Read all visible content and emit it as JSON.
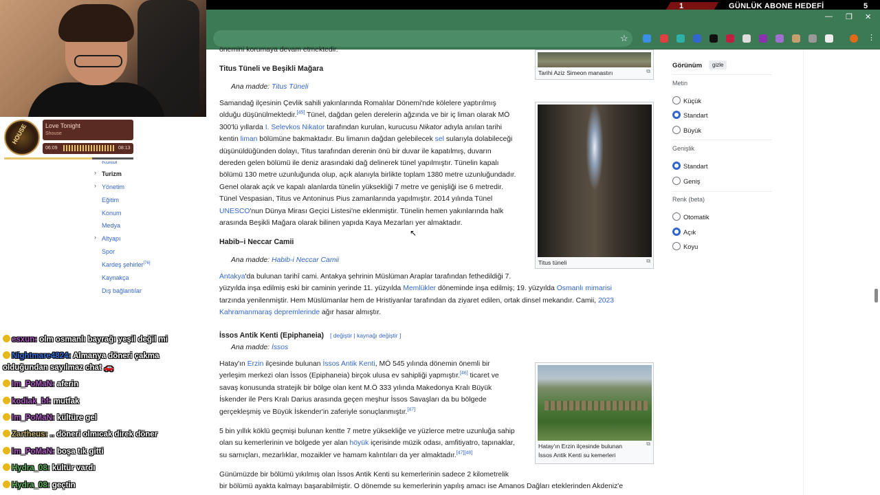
{
  "stream": {
    "goal_number": "1",
    "goal_label": "GÜNLÜK ABONE HEDEFİ",
    "goal_count": "5"
  },
  "music": {
    "album_text": "HOUSE",
    "title": "Love Tonight",
    "artist": "Shouse",
    "time_elapsed": "06:09",
    "time_total": "08:13",
    "progress_fraction": 0.68
  },
  "toc": {
    "items": [
      {
        "label": "Kültür",
        "has_chevron": false
      },
      {
        "label": "Turizm",
        "has_chevron": true,
        "active": true
      },
      {
        "label": "Yönetim",
        "has_chevron": true
      },
      {
        "label": "Eğitim",
        "has_chevron": false
      },
      {
        "label": "Konum",
        "has_chevron": false
      },
      {
        "label": "Medya",
        "has_chevron": false
      },
      {
        "label": "Altyapı",
        "has_chevron": true
      },
      {
        "label": "Spor",
        "has_chevron": false
      },
      {
        "label": "Kardeş şehirler",
        "sup": "[76]",
        "has_chevron": false
      },
      {
        "label": "Kaynakça",
        "has_chevron": false
      },
      {
        "label": "Dış bağlantılar",
        "has_chevron": false
      }
    ]
  },
  "chat": [
    {
      "user": "esxun:",
      "text": "olm osmanlı bayrağı yeşil değil mi",
      "color": "#b05cc2"
    },
    {
      "user": "Nightmare4824:",
      "text": "Almanya döneri çakma",
      "color": "#2f6fd6"
    },
    {
      "user": "",
      "text": "olduğundan sayılmaz chat 🚗",
      "color": "#ffffff"
    },
    {
      "user": "Im_PoMaN:",
      "text": "aferin",
      "color": "#b05cc2"
    },
    {
      "user": "kodiak_bf:",
      "text": "mutfak",
      "color": "#b05cc2"
    },
    {
      "user": "Im_PoMaN:",
      "text": "kültüre gel",
      "color": "#b05cc2"
    },
    {
      "user": "Zartheus:",
      "text": ".. döneri olmıcak direk döner",
      "color": "#c9b56a"
    },
    {
      "user": "Im_PoMaN:",
      "text": "boşa tık gitti",
      "color": "#b05cc2"
    },
    {
      "user": "Hydra_08:",
      "text": "kültür vardı",
      "color": "#5fb85a"
    },
    {
      "user": "Hydra_08:",
      "text": "geçtin",
      "color": "#5fb85a"
    }
  ],
  "article": {
    "top_fragment": "önemini korumaya devam etmektedir.",
    "section1": {
      "heading": "Titus Tüneli ve Beşikli Mağara",
      "hat_prefix": "Ana madde:",
      "hat_link": "Titus Tüneli",
      "lines": [
        [
          "Samandağ ilçesinin Çevlik sahili yakınlarında Romalılar Dönemi'nde kölelere yaptırılmış"
        ],
        [
          "olduğu düşünülmektedir.",
          {
            "sup": "[45]"
          },
          " Tünel, dağdan gelen derelerin ağzında ve bir iç liman olarak MÖ"
        ],
        [
          "300'lü yıllarda ",
          {
            "link": "I. Selevkos Nikator"
          },
          " tarafından kurulan, kurucusu ",
          {
            "i": "Nikator"
          },
          " adıyla anılan tarihi"
        ],
        [
          "kentin ",
          {
            "link": "liman"
          },
          " bölümüne bakmaktadır. Bu limanın dağdan gelebilecek ",
          {
            "link": "sel"
          },
          " sularıyla dolabileceği"
        ],
        [
          "düşünüldüğünden dolayı, Titus tarafından derenin önü bir duvar ile kapatılmış, duvarın"
        ],
        [
          "dereden gelen bölümü ile deniz arasındaki dağ delinerek tünel yapılmıştır. Tünelin kapalı"
        ],
        [
          "bölümü 130 metre uzunluğunda olup, açık alanıyla birlikte toplam 1380 metre uzunluğundadır."
        ],
        [
          "Genel olarak açık ve kapalı alanlarda tünelin yüksekliği 7 metre ve genişliği ise 6 metredir."
        ],
        [
          "Tünel Vespasian, Titus ve Antoninus Pius zamanlarında yapılmıştır. 2014 yılında Tünel"
        ],
        [
          {
            "link": "UNESCO"
          },
          "'nun Dünya Mirası Geçici Listesi'ne eklenmiştir. Tünelin hemen yakınlarında halk"
        ],
        [
          "arasında Beşikli Mağara olarak bilinen yapıda Kaya Mezarları yer almaktadır."
        ]
      ]
    },
    "section2": {
      "heading": "Habib–i Neccar Camii",
      "hat_prefix": "Ana madde:",
      "hat_link": "Habib-i Neccar Camii",
      "lines": [
        [
          {
            "link": "Antakya"
          },
          "'da bulunan tarihî cami. Antakya şehrinin Müslüman Araplar tarafından fethedildiği 7."
        ],
        [
          "yüzyılda inşa edilmiş eski bir caminin yerinde 11. yüzyılda ",
          {
            "link": "Memlükler"
          },
          " döneminde inşa edilmiş; 19. yüzyılda ",
          {
            "link": "Osmanlı mimarisi"
          }
        ],
        [
          "tarzında yenilenmiştir. Hem Müslümanlar hem de Hristiyanlar tarafından da ziyaret edilen, ortak dinsel mekandır. Camii, ",
          {
            "link": "2023"
          }
        ],
        [
          {
            "link": "Kahramanmaraş depremlerinde"
          },
          " ağır hasar almıştır."
        ]
      ]
    },
    "section3": {
      "heading": "İssos Antik Kenti (Epiphaneia)",
      "edit_links": "[ değiştir | kaynağı değiştir ]",
      "hat_prefix": "Ana madde:",
      "hat_link": "İssos",
      "para1": [
        [
          "Hatay'ın ",
          {
            "link": "Erzin"
          },
          " ilçesinde bulunan ",
          {
            "link": "İssos Antik Kenti"
          },
          ", MÖ 545 yılında dönemin önemli bir"
        ],
        [
          "yerleşim merkezi olan İssos (Epiphaneia) birçok ulusa ev sahipliği yapmıştır.",
          {
            "sup": "[46]"
          },
          " ticaret ve"
        ],
        [
          "savaş konusunda stratejik bir bölge olan kent M.Ö 333 yılında Makedonya Kralı Büyük"
        ],
        [
          "İskender ile Pers Kralı Darius arasında geçen meşhur İssos Savaşları da bu bölgede"
        ],
        [
          "gerçekleşmiş ve Büyük İskender'in zaferiyle sonuçlanmıştır.",
          {
            "sup": "[47]"
          }
        ]
      ],
      "para2": [
        [
          "5 bin yıllık köklü geçmişi bulunan kentte 7 metre yüksekliğe ve yüzlerce metre uzunluğa sahip"
        ],
        [
          "olan su kemerlerinin ve bölgede yer alan ",
          {
            "link": "höyük"
          },
          " içerisinde müzik odası, amfitiyatro, tapınaklar,"
        ],
        [
          "su sarnıçları, mezarlıklar, mozaikler ve hamam kalıntıları da yer almaktadır.",
          {
            "sup": "[47][48]"
          }
        ]
      ],
      "para3": [
        [
          "Günümüzde bir bölümü yıkılmış olan İssos Antik Kenti su kemerlerinin sadece 2 kilometrelik"
        ],
        [
          "bir bölümü ayakta kalmayı başarabilmiştir. O dönemde su kemerlerinin yapılış amacı ise Amanos Dağları eteklerinden Akdeniz'e"
        ]
      ]
    },
    "captions": {
      "simeon": "Tarihi Aziz Simeon manastırı",
      "titus": "Titus tüneli",
      "issos_line1": "Hatay'ın Erzin ilçesinde bulunan",
      "issos_line2": "İssos Antik Kenti su kemerleri"
    }
  },
  "appearance": {
    "title": "Görünüm",
    "hide_label": "gizle",
    "text_section": "Metin",
    "text_options": [
      {
        "label": "Küçük",
        "selected": false
      },
      {
        "label": "Standart",
        "selected": true
      },
      {
        "label": "Büyük",
        "selected": false
      }
    ],
    "width_section": "Genişlik",
    "width_options": [
      {
        "label": "Standart",
        "selected": true
      },
      {
        "label": "Geniş",
        "selected": false
      }
    ],
    "color_section": "Renk (beta)",
    "color_options": [
      {
        "label": "Otomatik",
        "selected": false
      },
      {
        "label": "Açık",
        "selected": true
      },
      {
        "label": "Koyu",
        "selected": false
      }
    ]
  }
}
